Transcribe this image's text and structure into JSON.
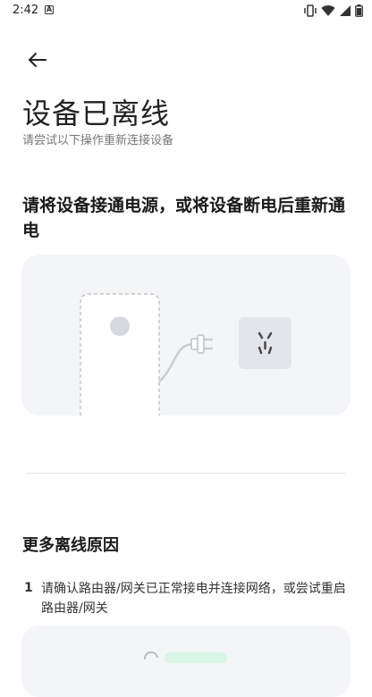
{
  "status_bar": {
    "time": "2:42",
    "notification_icon": "a-app-icon",
    "right_icons": [
      "vibrate-icon",
      "wifi-icon",
      "signal-icon",
      "battery-icon"
    ]
  },
  "header": {
    "back_icon": "arrow-left-icon",
    "title": "设备已离线",
    "subtitle": "请尝试以下操作重新连接设备"
  },
  "step": {
    "heading": "请将设备接通电源，或将设备断电后重新通电",
    "illustration": [
      "device-icon",
      "plug-icon",
      "socket-icon"
    ]
  },
  "more": {
    "heading": "更多离线原因",
    "reasons": [
      {
        "num": "1",
        "text": "请确认路由器/网关已正常接电并连接网络，或尝试重启路由器/网关"
      }
    ]
  },
  "colors": {
    "card_bg": "#f4f5f7",
    "device_border": "#b9b9b9",
    "socket_bg": "#e3e5ea",
    "accent_green": "#d8f5e6"
  }
}
